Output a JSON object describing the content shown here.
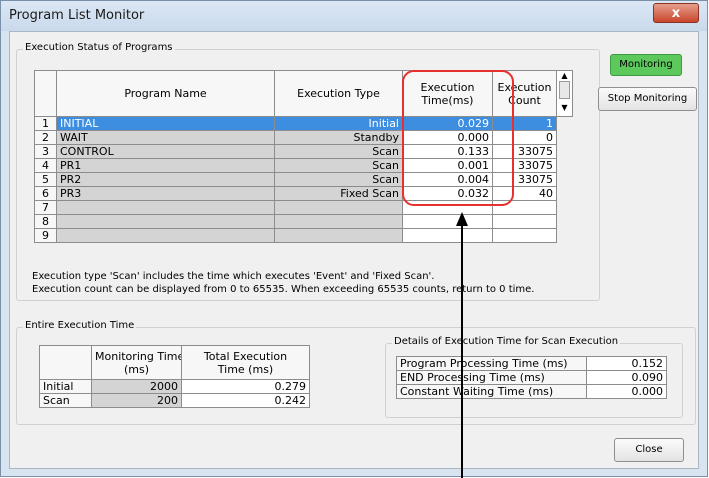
{
  "window": {
    "title": "Program List Monitor",
    "close_glyph": "x"
  },
  "exec_status": {
    "legend": "Execution Status of Programs",
    "columns": {
      "name": "Program Name",
      "type": "Execution Type",
      "time_l1": "Execution",
      "time_l2": "Time(ms)",
      "count_l1": "Execution",
      "count_l2": "Count"
    },
    "rows": [
      {
        "no": "1",
        "name": "INITIAL",
        "type": "Initial",
        "time": "0.029",
        "count": "1"
      },
      {
        "no": "2",
        "name": "WAIT",
        "type": "Standby",
        "time": "0.000",
        "count": "0"
      },
      {
        "no": "3",
        "name": "CONTROL",
        "type": "Scan",
        "time": "0.133",
        "count": "33075"
      },
      {
        "no": "4",
        "name": "PR1",
        "type": "Scan",
        "time": "0.001",
        "count": "33075"
      },
      {
        "no": "5",
        "name": "PR2",
        "type": "Scan",
        "time": "0.004",
        "count": "33075"
      },
      {
        "no": "6",
        "name": "PR3",
        "type": "Fixed Scan",
        "time": "0.032",
        "count": "40"
      },
      {
        "no": "7",
        "name": "",
        "type": "",
        "time": "",
        "count": ""
      },
      {
        "no": "8",
        "name": "",
        "type": "",
        "time": "",
        "count": ""
      },
      {
        "no": "9",
        "name": "",
        "type": "",
        "time": "",
        "count": ""
      }
    ],
    "note1": "Execution type 'Scan' includes the time which executes 'Event' and 'Fixed Scan'.",
    "note2": "Execution count can be displayed from 0 to 65535. When exceeding 65535 counts, return to 0 time."
  },
  "buttons": {
    "monitoring": "Monitoring",
    "stop": "Stop Monitoring",
    "close": "Close"
  },
  "entire": {
    "legend": "Entire Execution Time",
    "col_mon_l1": "Monitoring Time",
    "col_mon_l2": "(ms)",
    "col_tot_l1": "Total Execution",
    "col_tot_l2": "Time (ms)",
    "rows": [
      {
        "label": "Initial",
        "monitoring": "2000",
        "total": "0.279"
      },
      {
        "label": "Scan",
        "monitoring": "200",
        "total": "0.242"
      }
    ]
  },
  "details": {
    "legend": "Details of Execution Time for Scan Execution",
    "rows": [
      {
        "label": "Program Processing Time (ms)",
        "value": "0.152"
      },
      {
        "label": "END Processing Time (ms)",
        "value": "0.090"
      },
      {
        "label": "Constant Waiting Time (ms)",
        "value": "0.000"
      }
    ]
  },
  "colors": {
    "highlight": "#e8312e",
    "monitoring_bg": "#5dc95d",
    "selection": "#3d8ee0"
  }
}
